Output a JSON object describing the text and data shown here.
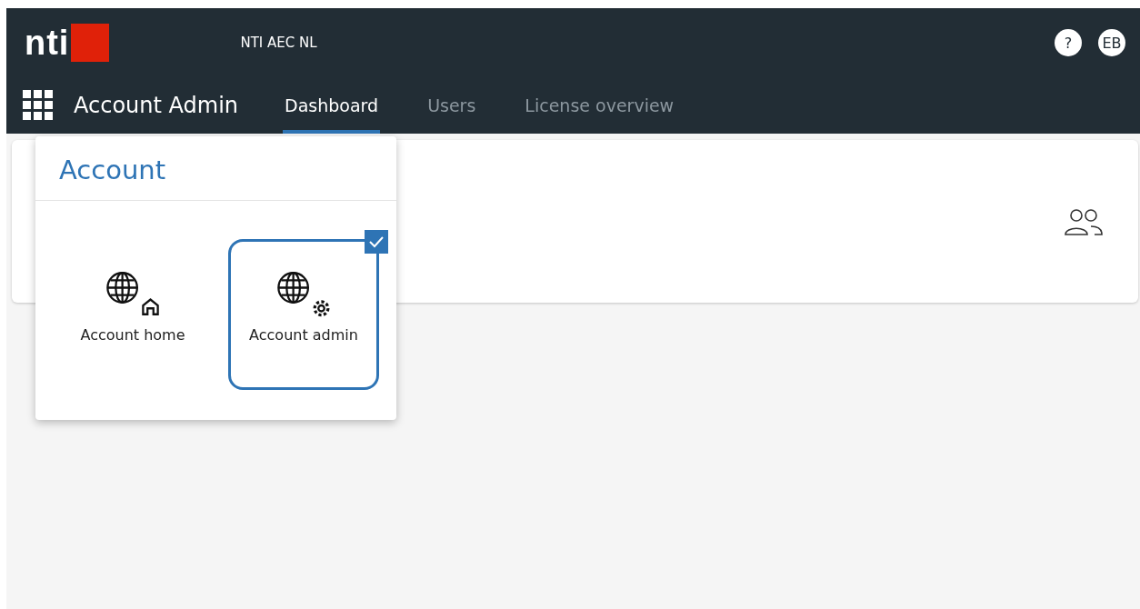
{
  "header": {
    "logo": "nti",
    "organization": "NTI AEC NL",
    "app_title": "Account Admin",
    "help": "?",
    "avatar": "EB"
  },
  "tabs": [
    {
      "label": "Dashboard",
      "selected": true
    },
    {
      "label": "Users",
      "selected": false
    },
    {
      "label": "License overview",
      "selected": false
    }
  ],
  "menu": {
    "title": "Account",
    "items": [
      {
        "label": "Account home",
        "kind": "home",
        "selected": false
      },
      {
        "label": "Account admin",
        "kind": "admin",
        "selected": true
      }
    ]
  }
}
